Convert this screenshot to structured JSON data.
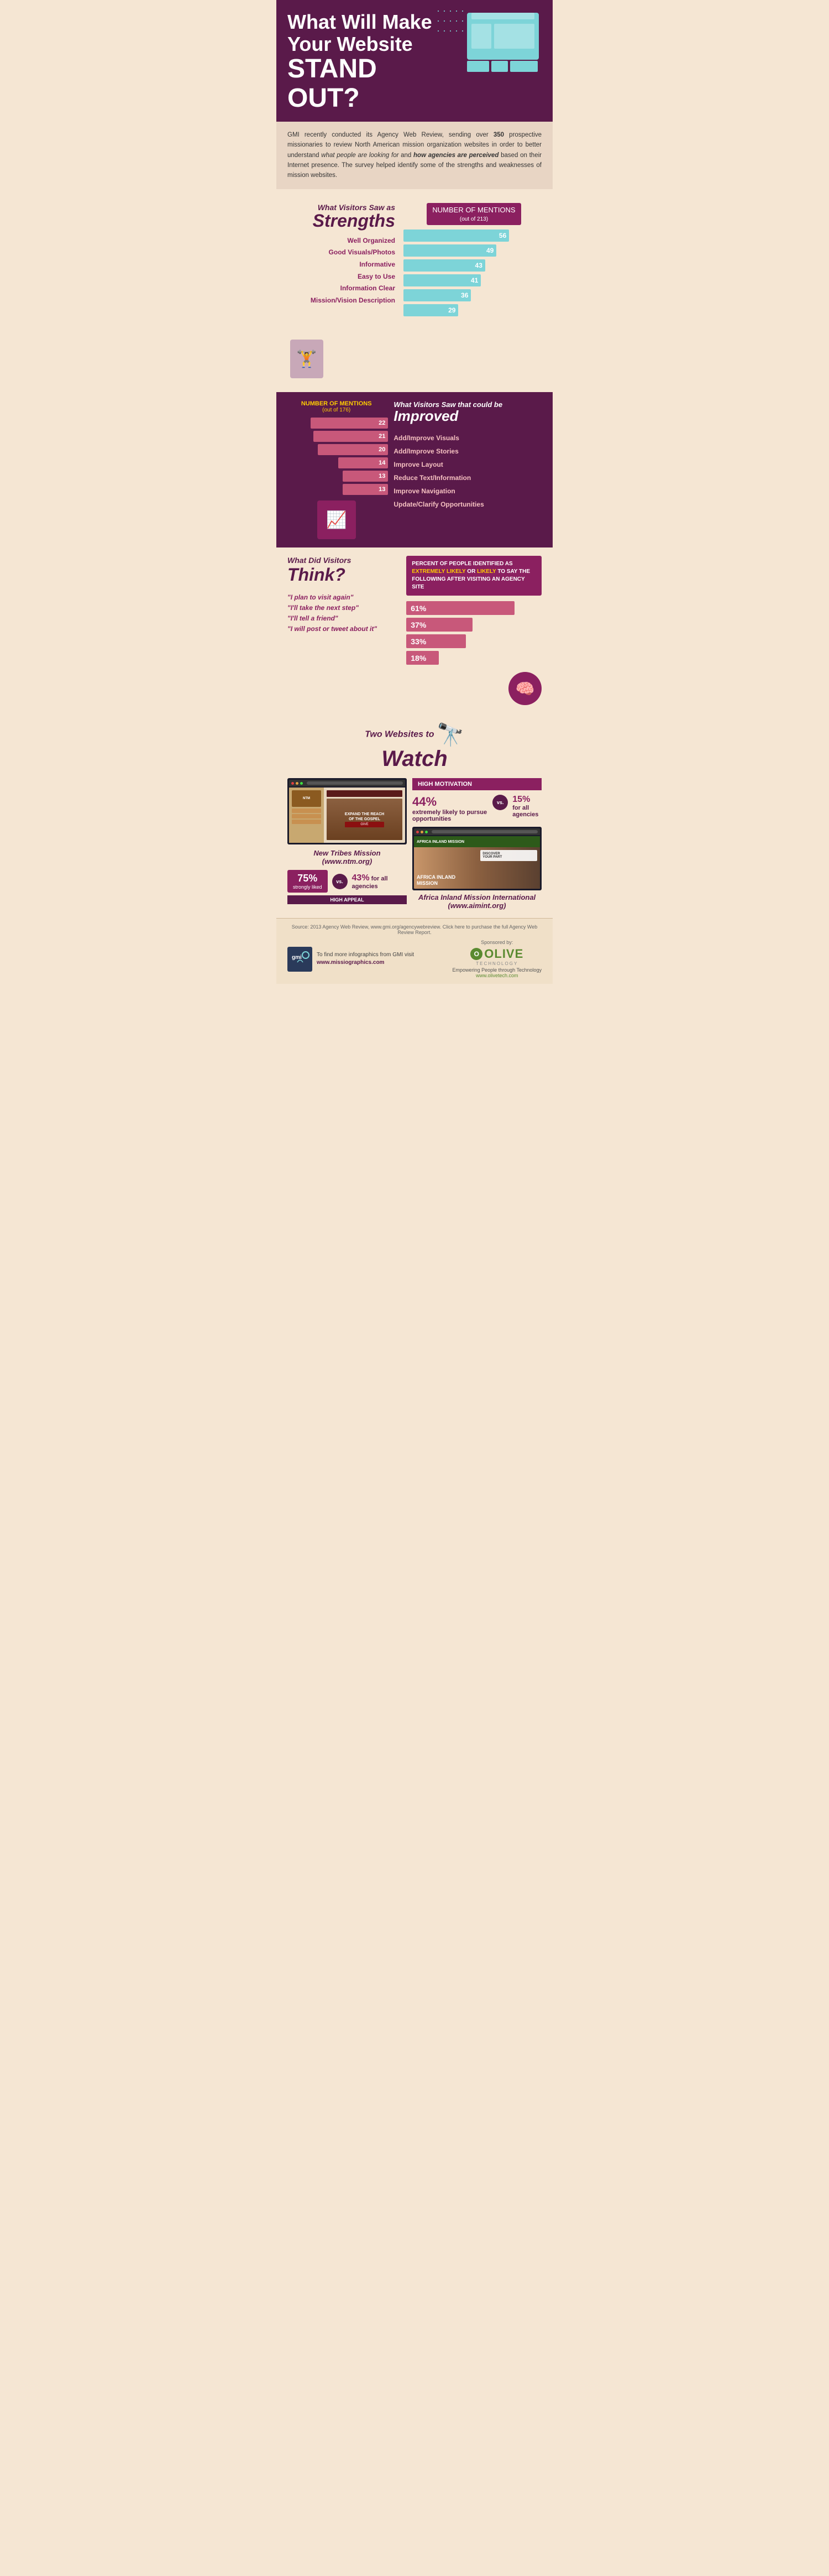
{
  "header": {
    "title_line1": "What Will Make",
    "title_line2": "Your Website",
    "title_line3": "STAND OUT?",
    "decoration_alt": "website mockup"
  },
  "intro": {
    "text_part1": "GMI recently conducted its Agency Web Review, sending over ",
    "bold1": "350",
    "text_part2": " prospective missionaries to review North American mission organization websites in order to better understand ",
    "italic1": "what people are looking for",
    "text_part3": " and ",
    "italic2": "how agencies are perceived",
    "text_part4": " based on their Internet presence. The survey helped identify some of the strengths and weaknesses of mission websites."
  },
  "strengths": {
    "label": "What Visitors Saw as",
    "title": "Strengths",
    "chart_header": "NUMBER OF MENTIONS",
    "chart_subheader": "(out of 213)",
    "items": [
      {
        "label": "Well Organized",
        "value": 56,
        "max": 213
      },
      {
        "label": "Good Visuals/Photos",
        "value": 49,
        "max": 213
      },
      {
        "label": "Informative",
        "value": 43,
        "max": 213
      },
      {
        "label": "Easy to Use",
        "value": 41,
        "max": 213
      },
      {
        "label": "Information Clear",
        "value": 36,
        "max": 213
      },
      {
        "label": "Mission/Vision Description",
        "value": 29,
        "max": 213
      }
    ]
  },
  "improved": {
    "label": "What Visitors Saw that could be",
    "title": "Improved",
    "chart_header": "NUMBER OF MENTIONS",
    "chart_subheader": "(out of 176)",
    "items": [
      {
        "label": "Add/Improve Visuals",
        "value": 22,
        "max": 176
      },
      {
        "label": "Add/Improve Stories",
        "value": 21,
        "max": 176
      },
      {
        "label": "Improve Layout",
        "value": 20,
        "max": 176
      },
      {
        "label": "Reduce Text/Information",
        "value": 14,
        "max": 176
      },
      {
        "label": "Improve Navigation",
        "value": 13,
        "max": 176
      },
      {
        "label": "Update/Clarify Opportunities",
        "value": 13,
        "max": 176
      }
    ]
  },
  "think": {
    "label": "What Did Visitors",
    "title": "Think?",
    "quotes": [
      "\"I plan to visit again\"",
      "\"I'll take the next step\"",
      "\"I'll tell a friend\"",
      "\"I will post or tweet about it\""
    ],
    "percent_header": "PERCENT OF PEOPLE IDENTIFIED AS",
    "highlight1": "EXTREMELY LIKELY",
    "connector": " OR ",
    "highlight2": "LIKELY",
    "percent_suffix": " TO SAY THE FOLLOWING AFTER VISITING AN AGENCY SITE",
    "percentages": [
      {
        "value": "61%",
        "width": 80
      },
      {
        "value": "37%",
        "width": 49
      },
      {
        "value": "33%",
        "width": 44
      },
      {
        "value": "18%",
        "width": 24
      }
    ]
  },
  "watch": {
    "label": "Two Websites to",
    "title": "Watch",
    "websites": [
      {
        "name": "New Tribes Mission",
        "url": "(www.ntm.org)",
        "stat1_value": "75%",
        "stat1_label": "strongly liked",
        "stat2_value": "43%",
        "stat2_label": "for all agencies",
        "tag": "HIGH APPEAL",
        "ntm_hero_text": "EXPAND THE REACH OF\nME GOSPEL"
      },
      {
        "name": "Africa Inland Mission International",
        "url": "(www.aimint.org)",
        "stat1_value": "44%",
        "stat1_label": "extremely likely to pursue opportunities",
        "stat2_value": "15%",
        "stat2_label": "for all agencies",
        "tag": "HIGH MOTIVATION",
        "aim_text": "AFRICA INLAND MISSION\nDISCOVER YOUR PART"
      }
    ]
  },
  "footer": {
    "source_text": "Source: 2013 Agency Web Review, www.gmi.org/agencywebreview. Click here to purchase the full Agency Web Review Report.",
    "gmi_label": "To find more infographics\nfrom GMI visit",
    "gmi_url": "www.missiographics.com",
    "sponsored_label": "Sponsored by:",
    "olive_name": "OLIVE",
    "olive_sub": "TECHNOLOGY",
    "olive_tagline": "Empowering People through Technology",
    "olive_url": "www.olivetech.com"
  }
}
